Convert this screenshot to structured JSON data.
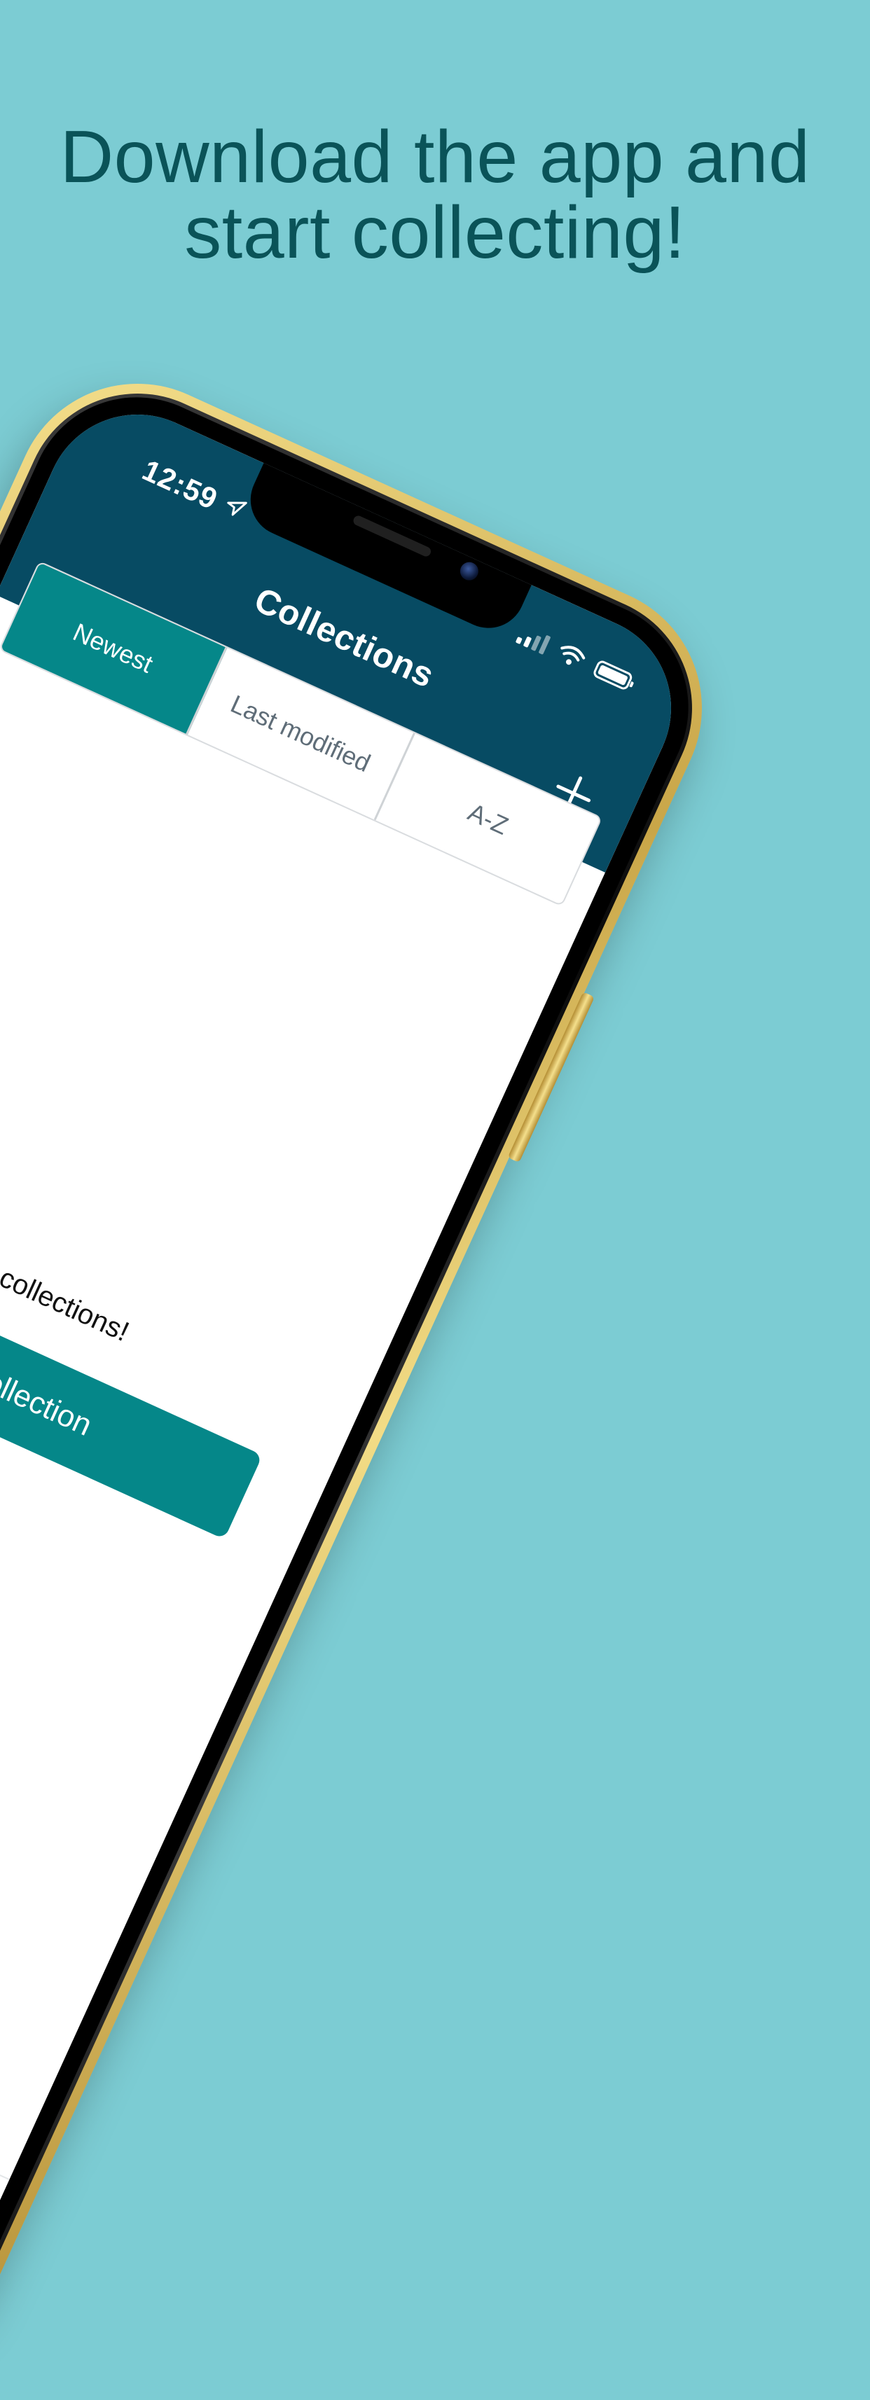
{
  "headline": {
    "line1": "Download the app and",
    "line2": "start collecting!"
  },
  "status_bar": {
    "time": "12:59"
  },
  "header": {
    "title": "Collections"
  },
  "tabs": [
    {
      "label": "Newest",
      "active": true
    },
    {
      "label": "Last modified",
      "active": false
    },
    {
      "label": "A-Z",
      "active": false
    }
  ],
  "empty_state": {
    "message": "No collections!",
    "button_label": "Add collection"
  },
  "colors": {
    "background": "#7cccd3",
    "headline": "#0a5358",
    "header": "#074b63",
    "accent": "#058789"
  },
  "icons": {
    "add": "plus-icon",
    "location": "location-arrow-icon",
    "signal": "cellular-signal-icon",
    "wifi": "wifi-icon",
    "battery": "battery-icon"
  }
}
